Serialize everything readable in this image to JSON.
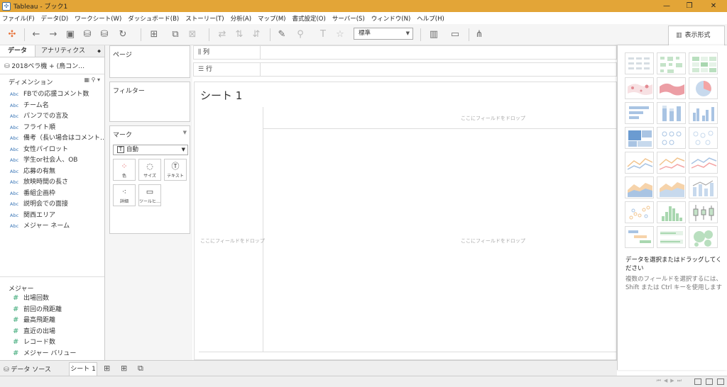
{
  "window": {
    "title": "Tableau - ブック1",
    "controls": [
      "—",
      "❐",
      "✕"
    ]
  },
  "menu": [
    "ファイル(F)",
    "データ(D)",
    "ワークシート(W)",
    "ダッシュボード(B)",
    "ストーリー(T)",
    "分析(A)",
    "マップ(M)",
    "書式設定(O)",
    "サーバー(S)",
    "ウィンドウ(N)",
    "ヘルプ(H)"
  ],
  "toolbar": {
    "fit_value": "標準",
    "show_me_label": "表示形式"
  },
  "left": {
    "tab_data": "データ",
    "tab_analytics": "アナリティクス",
    "datasource": "2018ベラ機 + (鳥コン…",
    "dimensions_header": "ディメンション",
    "dim_type": "Abc",
    "dimensions": [
      "FBでの応援コメント数",
      "チーム名",
      "パンフでの言及",
      "フライト順",
      "備考（長い場合はコメント…",
      "女性パイロット",
      "学生or社会人、OB",
      "応募の有無",
      "放映時間の長さ",
      "番組企画枠",
      "説明会での面接",
      "関西エリア",
      "メジャー ネーム"
    ],
    "measures_header": "メジャー",
    "measure_type": "#",
    "measures": [
      "出場回数",
      "前回の飛距離",
      "最高飛距離",
      "直近の出場",
      "レコード数",
      "メジャー バリュー"
    ]
  },
  "cards": {
    "pages": "ページ",
    "filters": "フィルター",
    "marks": "マーク",
    "mark_type": "自動",
    "mark_buttons": [
      "色",
      "サイズ",
      "テキスト",
      "詳細",
      "ツールヒ…"
    ]
  },
  "shelves": {
    "columns": "列",
    "rows": "行"
  },
  "sheet": {
    "title": "シート 1",
    "drop_hint": "ここにフィールドをドロップ"
  },
  "showme": {
    "message": "データを選択またはドラッグしてください",
    "hint": "複数のフィールドを選択するには、Shift または Ctrl キーを使用します"
  },
  "bottom": {
    "datasource_tab": "データ ソース",
    "sheet_tab": "シート 1"
  }
}
